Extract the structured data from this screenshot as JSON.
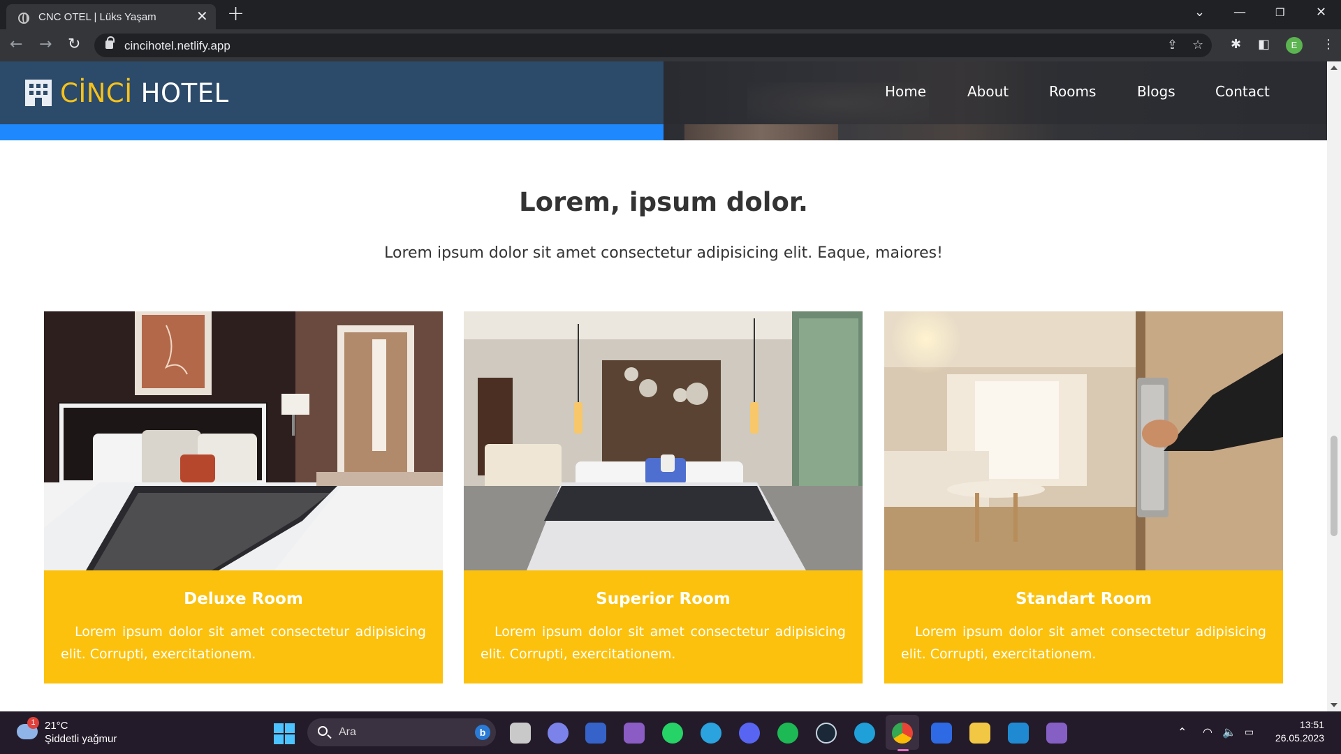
{
  "browser": {
    "tab_title": "CNC OTEL | Lüks Yaşam",
    "tab_close": "✕",
    "new_tab": "+",
    "url": "cincihotel.netlify.app",
    "profile_initial": "E"
  },
  "site": {
    "brand_first": "CİNCİ",
    "brand_second": "HOTEL",
    "nav": [
      "Home",
      "About",
      "Rooms",
      "Blogs",
      "Contact"
    ],
    "section_title": "Lorem, ipsum dolor.",
    "section_subtitle": "Lorem ipsum dolor sit amet consectetur adipisicing elit. Eaque, maiores!",
    "rooms": [
      {
        "title": "Deluxe Room",
        "text": "Lorem ipsum dolor sit amet consectetur adipisicing elit. Corrupti, exercitationem."
      },
      {
        "title": "Superior Room",
        "text": "Lorem ipsum dolor sit amet consectetur adipisicing elit. Corrupti, exercitationem."
      },
      {
        "title": "Standart Room",
        "text": "Lorem ipsum dolor sit amet consectetur adipisicing elit. Corrupti, exercitationem."
      }
    ],
    "colors": {
      "header_blue": "#2c4a6a",
      "accent_blue": "#1e88ff",
      "brand_yellow": "#f6c21a",
      "card_yellow": "#fcc10c"
    }
  },
  "taskbar": {
    "weather_badge": "1",
    "temperature": "21°C",
    "condition": "Şiddetli yağmur",
    "search_label": "Ara",
    "time": "13:51",
    "date": "26.05.2023",
    "apps": [
      "file-explorer-icon",
      "teams-icon",
      "notepad-icon",
      "clipchamp-icon",
      "whatsapp-icon",
      "telegram-icon",
      "discord-icon",
      "spotify-icon",
      "steam-icon",
      "edge-icon",
      "chrome-icon",
      "notion-icon",
      "paint-icon",
      "vscode-icon",
      "visual-studio-icon"
    ]
  }
}
